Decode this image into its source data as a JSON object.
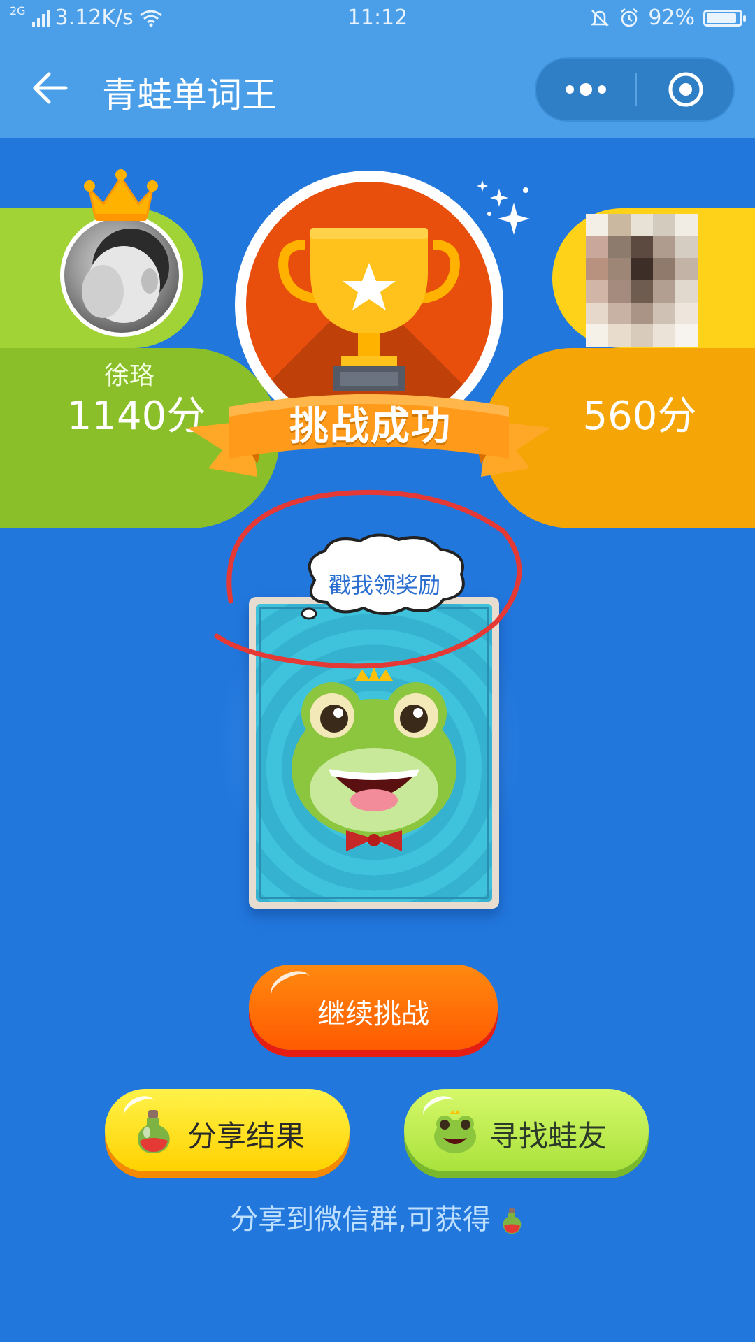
{
  "status_bar": {
    "network": "2G",
    "speed": "3.12K/s",
    "time": "11:12",
    "battery": "92%",
    "battery_level": 0.92
  },
  "nav": {
    "title": "青蛙单词王"
  },
  "players": {
    "left": {
      "name": "徐珞",
      "score": "1140分"
    },
    "right": {
      "score": "560分"
    }
  },
  "result": {
    "banner": "挑战成功"
  },
  "reward": {
    "bubble_text": "戳我领奖励"
  },
  "buttons": {
    "continue": "继续挑战",
    "share": "分享结果",
    "find_friends": "寻找蛙友"
  },
  "share_hint": "分享到微信群,可获得",
  "colors": {
    "background": "#2277dd",
    "nav": "#4a9fe8",
    "green_panel": "#8bbf2a",
    "orange_panel": "#f6a506",
    "continue_button": "#ff6a00",
    "share_button": "#ffe020",
    "find_button": "#b8ea4c"
  }
}
